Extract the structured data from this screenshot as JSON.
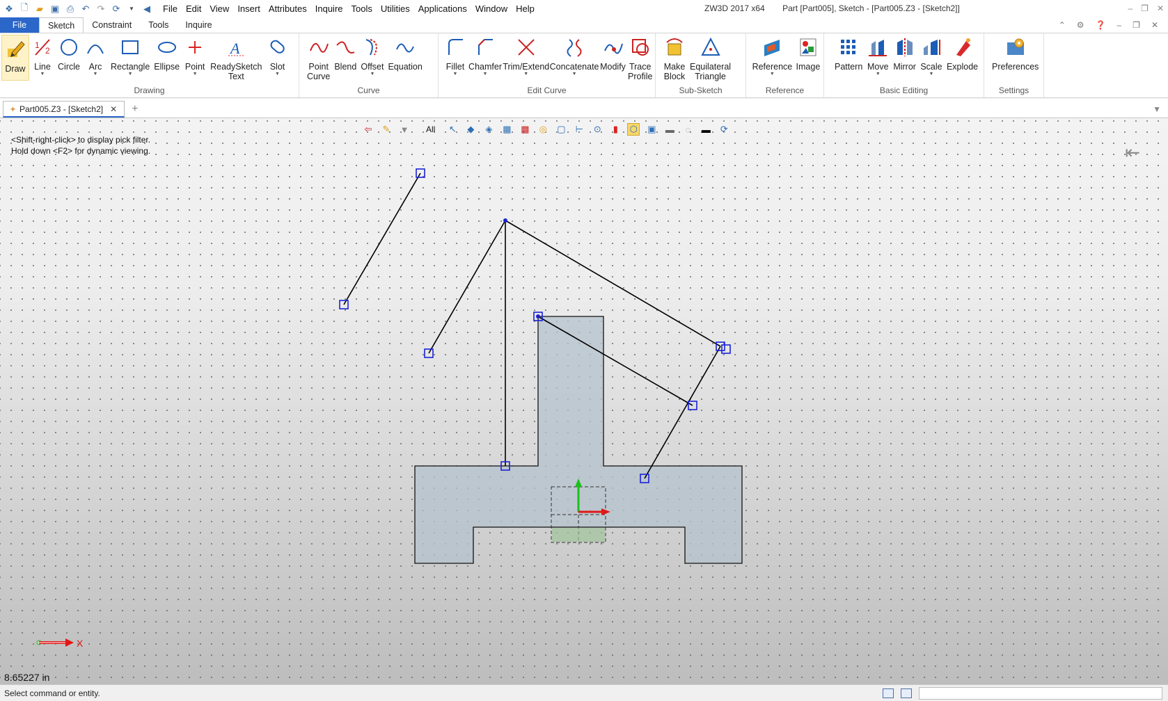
{
  "title": {
    "app": "ZW3D 2017  x64",
    "doc": "Part [Part005],  Sketch - [Part005.Z3 - [Sketch2]]"
  },
  "menu": [
    "File",
    "Edit",
    "View",
    "Insert",
    "Attributes",
    "Inquire",
    "Tools",
    "Utilities",
    "Applications",
    "Window",
    "Help"
  ],
  "ribbon_tabs": [
    "File",
    "Sketch",
    "Constraint",
    "Tools",
    "Inquire"
  ],
  "ribbon": {
    "groups": [
      {
        "label": "Drawing",
        "commands": [
          "Draw",
          "Line",
          "Circle",
          "Arc",
          "Rectangle",
          "Ellipse",
          "Point",
          "ReadySketch\nText",
          "Slot"
        ]
      },
      {
        "label": "Curve",
        "commands": [
          "Point\nCurve",
          "Blend",
          "Offset",
          "Equation"
        ]
      },
      {
        "label": "Edit Curve",
        "commands": [
          "Fillet",
          "Chamfer",
          "Trim/Extend",
          "Concatenate",
          "Modify",
          "Trace\nProfile"
        ]
      },
      {
        "label": "Sub-Sketch",
        "commands": [
          "Make\nBlock",
          "Equilateral\nTriangle"
        ]
      },
      {
        "label": "Reference",
        "commands": [
          "Reference",
          "Image"
        ]
      },
      {
        "label": "Basic Editing",
        "commands": [
          "Pattern",
          "Move",
          "Mirror",
          "Scale",
          "Explode"
        ]
      },
      {
        "label": "Settings",
        "commands": [
          "Preferences"
        ]
      }
    ]
  },
  "document_tab": "Part005.Z3 - [Sketch2]",
  "viewport": {
    "hint_line1": "<Shift-right-click> to display pick filter.",
    "hint_line2": "Hold down <F2> for dynamic viewing.",
    "filter_label": "All",
    "axis_label": "X",
    "measurement": "8.65227 in"
  },
  "status": {
    "message": "Select command or entity."
  },
  "colors": {
    "accent": "#2b66c9",
    "profile_fill": "#b4c2cc",
    "handle": "#1a22d6",
    "axis_x": "#e01818",
    "axis_y": "#19c119"
  }
}
